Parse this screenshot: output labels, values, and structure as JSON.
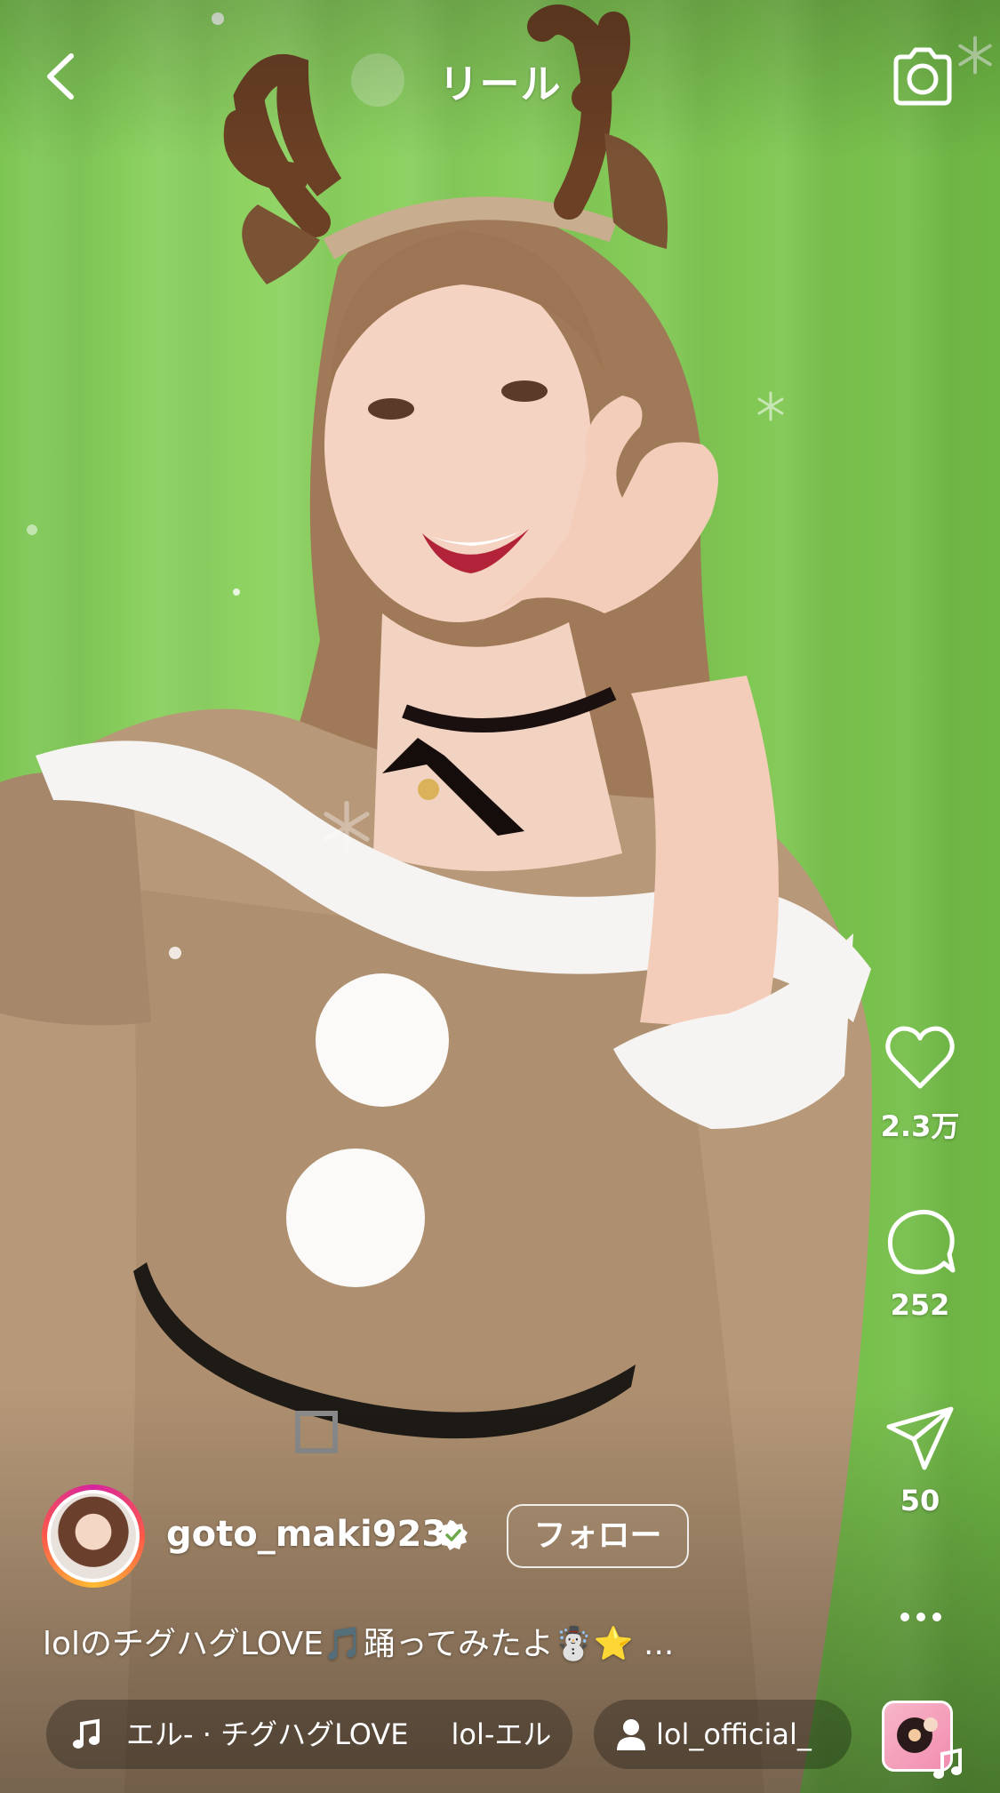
{
  "header": {
    "title": "リール"
  },
  "actions": {
    "likes": "2.3万",
    "comments": "252",
    "shares": "50"
  },
  "author": {
    "username": "goto_maki923",
    "follow_label": "フォロー"
  },
  "caption": "lolのチグハグLOVE🎵踊ってみたよ☃️⭐️ ...",
  "audio": {
    "track": "エル- · チグハグLOVE",
    "track_repeat": "lol-エル",
    "tagged_user": "lol_official_"
  },
  "icons": {
    "back": "chevron-left-icon",
    "camera": "camera-icon",
    "like": "heart-icon",
    "comment": "comment-bubble-icon",
    "share": "paper-plane-icon",
    "more": "more-dots-icon",
    "music": "music-note-icon",
    "user": "person-icon"
  },
  "colors": {
    "backdrop_green": "#86cc5a",
    "story_ring": "#d6249f",
    "text": "#ffffff"
  }
}
